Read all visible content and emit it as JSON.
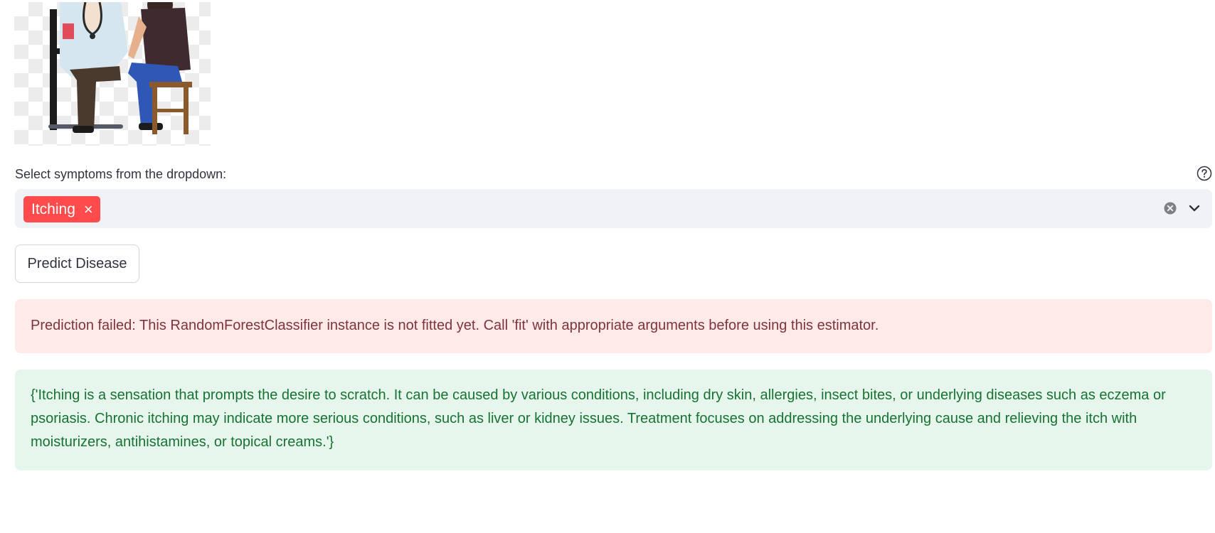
{
  "form": {
    "label": "Select symptoms from the dropdown:",
    "selected": [
      {
        "label": "Itching",
        "remove_glyph": "×"
      }
    ],
    "clear_icon": "clear-circle-icon",
    "dropdown_icon": "chevron-down-icon",
    "help_icon": "question-circle-icon"
  },
  "actions": {
    "predict_label": "Predict Disease"
  },
  "messages": {
    "error": "Prediction failed: This RandomForestClassifier instance is not fitted yet. Call 'fit' with appropriate arguments before using this estimator.",
    "info": "{'Itching is a sensation that prompts the desire to scratch. It can be caused by various conditions, including dry skin, allergies, insect bites, or underlying diseases such as eczema or psoriasis. Chronic itching may indicate more serious conditions, such as liver or kidney issues. Treatment focuses on addressing the underlying cause and relieving the itch with moisturizers, antihistamines, or topical creams.'}"
  },
  "colors": {
    "accent": "#ff4b4b",
    "error_bg": "#ffe9e9",
    "error_text": "#7d353b",
    "success_bg": "#e6f6ec",
    "success_text": "#177233",
    "input_bg": "#f0f2f6"
  }
}
